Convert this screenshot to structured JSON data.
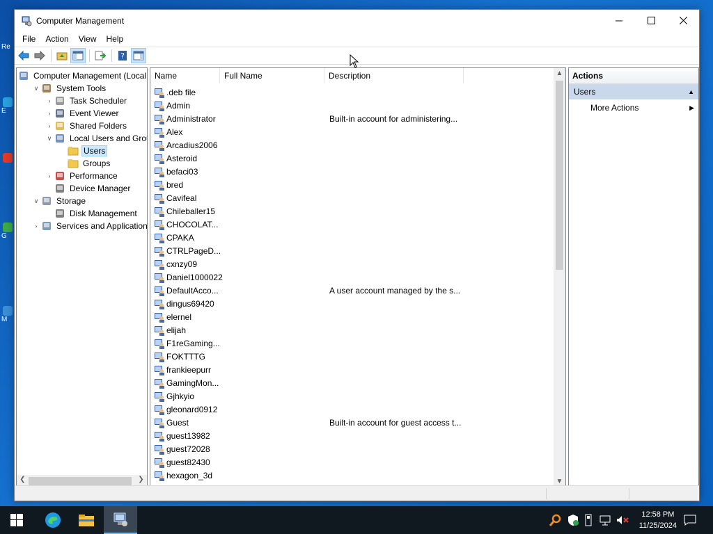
{
  "window": {
    "title": "Computer Management"
  },
  "menu": [
    "File",
    "Action",
    "View",
    "Help"
  ],
  "tree": [
    {
      "label": "Computer Management (Local",
      "indent": 0,
      "exp": "",
      "icon": "computer-management-icon"
    },
    {
      "label": "System Tools",
      "indent": 1,
      "exp": "v",
      "icon": "system-tools-icon"
    },
    {
      "label": "Task Scheduler",
      "indent": 2,
      "exp": ">",
      "icon": "task-scheduler-icon"
    },
    {
      "label": "Event Viewer",
      "indent": 2,
      "exp": ">",
      "icon": "event-viewer-icon"
    },
    {
      "label": "Shared Folders",
      "indent": 2,
      "exp": ">",
      "icon": "shared-folders-icon"
    },
    {
      "label": "Local Users and Groups",
      "indent": 2,
      "exp": "v",
      "icon": "users-groups-icon"
    },
    {
      "label": "Users",
      "indent": 3,
      "exp": "",
      "icon": "folder-icon",
      "selected": true
    },
    {
      "label": "Groups",
      "indent": 3,
      "exp": "",
      "icon": "folder-icon"
    },
    {
      "label": "Performance",
      "indent": 2,
      "exp": ">",
      "icon": "performance-icon"
    },
    {
      "label": "Device Manager",
      "indent": 2,
      "exp": "",
      "icon": "device-manager-icon"
    },
    {
      "label": "Storage",
      "indent": 1,
      "exp": "v",
      "icon": "storage-icon"
    },
    {
      "label": "Disk Management",
      "indent": 2,
      "exp": "",
      "icon": "disk-management-icon"
    },
    {
      "label": "Services and Applications",
      "indent": 1,
      "exp": ">",
      "icon": "services-icon"
    }
  ],
  "columns": [
    "Name",
    "Full Name",
    "Description"
  ],
  "users": [
    {
      "name": ".deb file",
      "desc": ""
    },
    {
      "name": "Admin",
      "desc": ""
    },
    {
      "name": "Administrator",
      "desc": "Built-in account for administering..."
    },
    {
      "name": "Alex",
      "desc": ""
    },
    {
      "name": "Arcadius2006",
      "desc": ""
    },
    {
      "name": "Asteroid",
      "desc": ""
    },
    {
      "name": "befaci03",
      "desc": ""
    },
    {
      "name": "bred",
      "desc": ""
    },
    {
      "name": "Cavifeal",
      "desc": ""
    },
    {
      "name": "Chileballer15",
      "desc": ""
    },
    {
      "name": "CHOCOLAT...",
      "desc": ""
    },
    {
      "name": "CPAKA",
      "desc": ""
    },
    {
      "name": "CTRLPageD...",
      "desc": ""
    },
    {
      "name": "cxnzy09",
      "desc": ""
    },
    {
      "name": "Daniel1000022",
      "desc": ""
    },
    {
      "name": "DefaultAcco...",
      "desc": "A user account managed by the s..."
    },
    {
      "name": "dingus69420",
      "desc": ""
    },
    {
      "name": "elernel",
      "desc": ""
    },
    {
      "name": "elijah",
      "desc": ""
    },
    {
      "name": "F1reGaming...",
      "desc": ""
    },
    {
      "name": "FOKTTTG",
      "desc": ""
    },
    {
      "name": "frankieepurr",
      "desc": ""
    },
    {
      "name": "GamingMon...",
      "desc": ""
    },
    {
      "name": "Gjhkyio",
      "desc": ""
    },
    {
      "name": "gleonard0912",
      "desc": ""
    },
    {
      "name": "Guest",
      "desc": "Built-in account for guest access t..."
    },
    {
      "name": "guest13982",
      "desc": ""
    },
    {
      "name": "guest72028",
      "desc": ""
    },
    {
      "name": "guest82430",
      "desc": ""
    },
    {
      "name": "hexagon_3d",
      "desc": ""
    }
  ],
  "actions": {
    "header": "Actions",
    "section": "Users",
    "items": [
      "More Actions"
    ]
  },
  "taskbar": {
    "time": "12:58 PM",
    "date": "11/25/2024"
  }
}
